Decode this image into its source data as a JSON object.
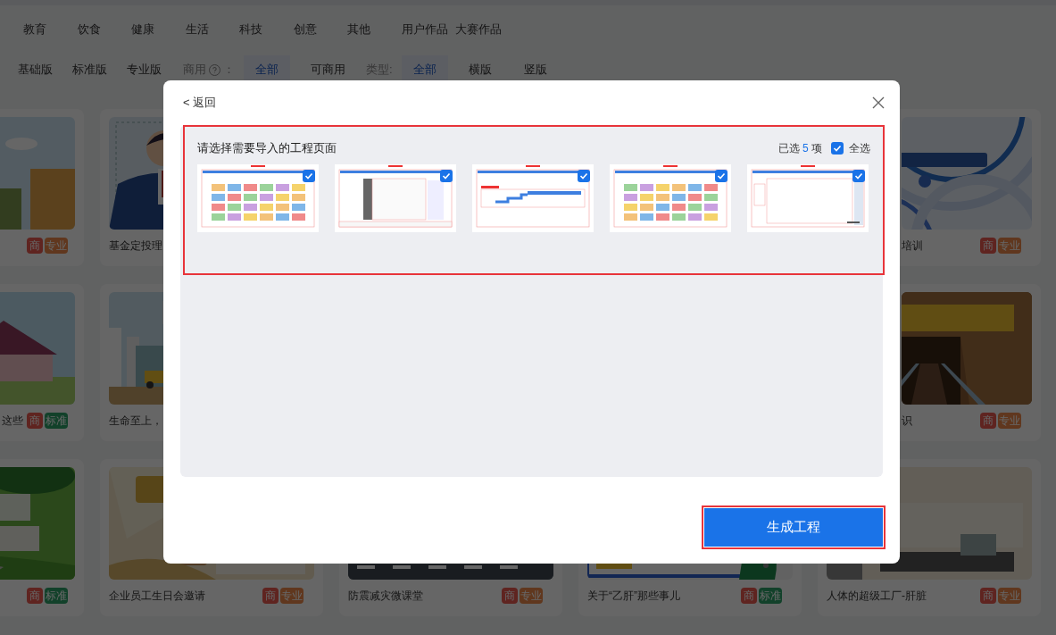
{
  "filters": {
    "categories": [
      {
        "label": "教育"
      },
      {
        "label": "饮食"
      },
      {
        "label": "健康"
      },
      {
        "label": "生活"
      },
      {
        "label": "科技"
      },
      {
        "label": "创意"
      },
      {
        "label": "其他"
      },
      {
        "label": "用户作品"
      },
      {
        "label": "大赛作品"
      }
    ],
    "editions": [
      {
        "label": "基础版"
      },
      {
        "label": "标准版"
      },
      {
        "label": "专业版"
      }
    ],
    "commercial": {
      "label": "商用",
      "suffix": "：",
      "options": [
        {
          "label": "全部",
          "selected": true
        },
        {
          "label": "可商用",
          "selected": false
        }
      ]
    },
    "type": {
      "label": "类型:",
      "options": [
        {
          "label": "全部",
          "selected": true
        },
        {
          "label": "横版",
          "selected": false
        },
        {
          "label": "竖版",
          "selected": false
        }
      ]
    }
  },
  "card_rows": [
    [
      {
        "kind": "picture",
        "badges": [
          {
            "label": "商",
            "kind": "commercial"
          },
          {
            "label": "专业",
            "kind": "pro"
          }
        ]
      },
      {
        "kind": "picture",
        "title": "基金定投理"
      },
      null,
      null,
      {
        "kind": "picture",
        "title": "培训",
        "badges": [
          {
            "label": "商",
            "kind": "commercial"
          },
          {
            "label": "专业",
            "kind": "pro"
          }
        ]
      }
    ],
    [
      {
        "kind": "picture",
        "title": "这些",
        "badges": [
          {
            "label": "商",
            "kind": "commercial"
          },
          {
            "label": "标准",
            "kind": "standard"
          }
        ]
      },
      {
        "kind": "picture",
        "title": "生命至上，"
      },
      null,
      null,
      {
        "kind": "picture",
        "title": "识",
        "badges": [
          {
            "label": "商",
            "kind": "commercial"
          },
          {
            "label": "专业",
            "kind": "pro"
          }
        ]
      }
    ],
    [
      {
        "kind": "picture",
        "badges": [
          {
            "label": "商",
            "kind": "commercial"
          },
          {
            "label": "标准",
            "kind": "standard"
          }
        ]
      },
      {
        "kind": "picture",
        "title": "企业员工生日会邀请",
        "badges": [
          {
            "label": "商",
            "kind": "commercial"
          },
          {
            "label": "专业",
            "kind": "pro"
          }
        ]
      },
      {
        "kind": "picture",
        "title": "防震减灾微课堂",
        "badges": [
          {
            "label": "商",
            "kind": "commercial"
          },
          {
            "label": "专业",
            "kind": "pro"
          }
        ]
      },
      {
        "kind": "picture",
        "title": "关于“乙肝”那些事儿",
        "badges": [
          {
            "label": "商",
            "kind": "commercial"
          },
          {
            "label": "标准",
            "kind": "standard"
          }
        ]
      },
      {
        "kind": "picture",
        "title": "人体的超级工厂-肝脏",
        "badges": [
          {
            "label": "商",
            "kind": "commercial"
          },
          {
            "label": "专业",
            "kind": "pro"
          }
        ]
      }
    ]
  ],
  "dialog": {
    "back": "< 返回",
    "heading": "请选择需要导入的工程页面",
    "selection": {
      "prefix": "已选",
      "count": "5",
      "suffix": "项"
    },
    "select_all": {
      "label": "全选",
      "checked": true
    },
    "pages": [
      {
        "checked": true
      },
      {
        "checked": true
      },
      {
        "checked": true
      },
      {
        "checked": true
      },
      {
        "checked": true
      }
    ],
    "primary_button": "生成工程"
  }
}
